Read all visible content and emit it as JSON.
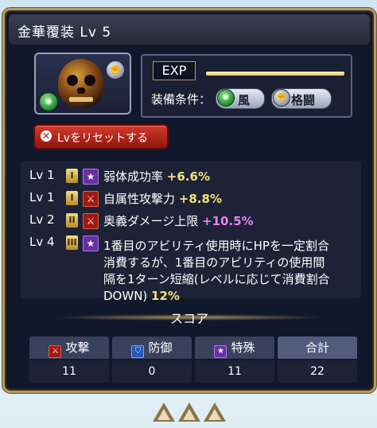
{
  "window": {
    "title": "金華覆装 Lv 5"
  },
  "item": {
    "icon": "skull-icon",
    "element_icon": "wind-icon",
    "type_icon": "fist-icon"
  },
  "exp": {
    "label": "EXP",
    "progress": 1.0
  },
  "equip": {
    "label": "装備条件：",
    "element": "風",
    "weapon": "格闘"
  },
  "reset_button": {
    "label": "Lvをリセットする"
  },
  "skills": [
    {
      "lv": "Lv 1",
      "tier": "I",
      "type": "special",
      "name": "弱体成功率",
      "bonus": "+6.6%",
      "bonus_color": "yellow"
    },
    {
      "lv": "Lv 1",
      "tier": "I",
      "type": "attack",
      "name": "自属性攻撃力",
      "bonus": "+8.8%",
      "bonus_color": "yellow"
    },
    {
      "lv": "Lv 2",
      "tier": "II",
      "type": "attack",
      "name": "奥義ダメージ上限",
      "bonus": "+10.5%",
      "bonus_color": "purple"
    },
    {
      "lv": "Lv 4",
      "tier": "III",
      "type": "special",
      "text_lines": [
        "1番目のアビリティ使用時にHPを一定割合",
        "消費するが、1番目のアビリティの使用間",
        "隔を1ターン短縮(レベルに応じて消費割合"
      ],
      "last_line": "DOWN)",
      "bonus": "12%"
    }
  ],
  "score": {
    "label": "スコア",
    "columns": [
      {
        "name": "攻撃",
        "value": "11",
        "icon": "sword-icon"
      },
      {
        "name": "防御",
        "value": "0",
        "icon": "shield-icon"
      },
      {
        "name": "特殊",
        "value": "11",
        "icon": "star-icon"
      },
      {
        "name": "合計",
        "value": "22",
        "icon": ""
      }
    ]
  },
  "colors": {
    "panel_bg": "#12182c",
    "border_gold": "#b79a5e",
    "bonus_yellow": "#f4e27a",
    "bonus_purple": "#e782f2",
    "reset_red": "#c12a1e"
  }
}
